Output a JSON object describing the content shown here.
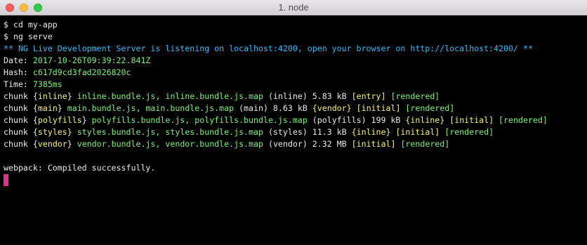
{
  "window": {
    "title": "1. node"
  },
  "colors": {
    "background": "#000000",
    "default_text": "#eaeaea",
    "info_blue": "#38b8f7",
    "highlight_yellow": "#f6f27c",
    "data_green": "#7ff07a",
    "cursor_pink": "#d6348a"
  },
  "terminal": {
    "lines": [
      [
        {
          "t": "$ cd my-app",
          "c": "default"
        }
      ],
      [
        {
          "t": "$ ng serve",
          "c": "default"
        }
      ],
      [
        {
          "t": "** NG Live Development Server is listening on localhost:4200, open your browser on http://localhost:4200/ **",
          "c": "blue"
        }
      ],
      [
        {
          "t": "Date: ",
          "c": "default"
        },
        {
          "t": "2017-10-26T09:39:22.841Z",
          "c": "green"
        }
      ],
      [
        {
          "t": "Hash: ",
          "c": "default"
        },
        {
          "t": "c617d9cd3fad2026820c",
          "c": "green"
        }
      ],
      [
        {
          "t": "Time: ",
          "c": "default"
        },
        {
          "t": "7385ms",
          "c": "green"
        }
      ],
      [
        {
          "t": "chunk {",
          "c": "default"
        },
        {
          "t": "inline",
          "c": "yellow"
        },
        {
          "t": "} ",
          "c": "default"
        },
        {
          "t": "inline.bundle.js, inline.bundle.js.map",
          "c": "green"
        },
        {
          "t": " (inline) 5.83 kB ",
          "c": "default"
        },
        {
          "t": "[entry]",
          "c": "yellow"
        },
        {
          "t": " ",
          "c": "default"
        },
        {
          "t": "[rendered]",
          "c": "green"
        }
      ],
      [
        {
          "t": "chunk {",
          "c": "default"
        },
        {
          "t": "main",
          "c": "yellow"
        },
        {
          "t": "} ",
          "c": "default"
        },
        {
          "t": "main.bundle.js, main.bundle.js.map",
          "c": "green"
        },
        {
          "t": " (main) 8.63 kB ",
          "c": "default"
        },
        {
          "t": "{vendor}",
          "c": "yellow"
        },
        {
          "t": " ",
          "c": "default"
        },
        {
          "t": "[initial]",
          "c": "yellow"
        },
        {
          "t": " ",
          "c": "default"
        },
        {
          "t": "[rendered]",
          "c": "green"
        }
      ],
      [
        {
          "t": "chunk {",
          "c": "default"
        },
        {
          "t": "polyfills",
          "c": "yellow"
        },
        {
          "t": "} ",
          "c": "default"
        },
        {
          "t": "polyfills.bundle.js, polyfills.bundle.js.map",
          "c": "green"
        },
        {
          "t": " (polyfills) 199 kB ",
          "c": "default"
        },
        {
          "t": "{inline}",
          "c": "yellow"
        },
        {
          "t": " ",
          "c": "default"
        },
        {
          "t": "[initial]",
          "c": "yellow"
        },
        {
          "t": " ",
          "c": "default"
        },
        {
          "t": "[rendered]",
          "c": "green"
        }
      ],
      [
        {
          "t": "chunk {",
          "c": "default"
        },
        {
          "t": "styles",
          "c": "yellow"
        },
        {
          "t": "} ",
          "c": "default"
        },
        {
          "t": "styles.bundle.js, styles.bundle.js.map",
          "c": "green"
        },
        {
          "t": " (styles) 11.3 kB ",
          "c": "default"
        },
        {
          "t": "{inline}",
          "c": "yellow"
        },
        {
          "t": " ",
          "c": "default"
        },
        {
          "t": "[initial]",
          "c": "yellow"
        },
        {
          "t": " ",
          "c": "default"
        },
        {
          "t": "[rendered]",
          "c": "green"
        }
      ],
      [
        {
          "t": "chunk {",
          "c": "default"
        },
        {
          "t": "vendor",
          "c": "yellow"
        },
        {
          "t": "} ",
          "c": "default"
        },
        {
          "t": "vendor.bundle.js, vendor.bundle.js.map",
          "c": "green"
        },
        {
          "t": " (vendor) 2.32 MB ",
          "c": "default"
        },
        {
          "t": "[initial]",
          "c": "yellow"
        },
        {
          "t": " ",
          "c": "default"
        },
        {
          "t": "[rendered]",
          "c": "green"
        }
      ],
      [],
      [
        {
          "t": "webpack: Compiled successfully.",
          "c": "default"
        }
      ]
    ],
    "cursor": "block-cursor"
  }
}
